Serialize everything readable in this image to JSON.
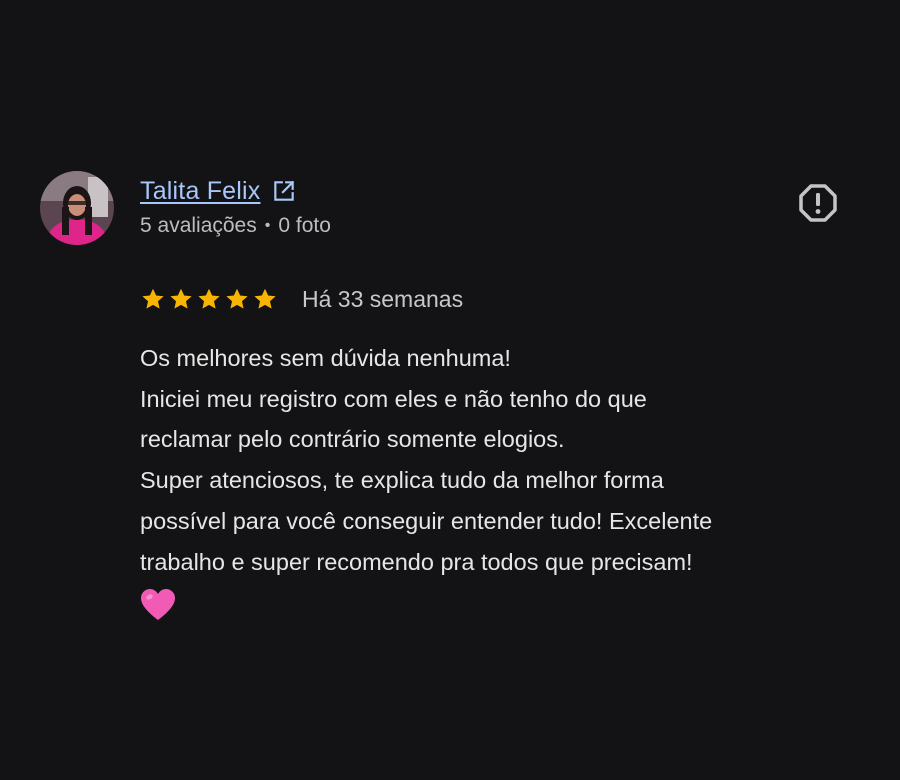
{
  "review": {
    "author": {
      "name": "Talita Felix",
      "reviews_count": "5 avaliações",
      "separator": "•",
      "photos_count": "0 foto"
    },
    "rating": 5,
    "time_ago": "Há 33 semanas",
    "text_lines": [
      "Os melhores sem dúvida nenhuma!",
      "Iniciei meu registro com eles e não tenho do que",
      "reclamar pelo contrário somente elogios.",
      "Super atenciosos, te explica tudo da melhor forma",
      "possível para você conseguir entender tudo! Excelente",
      "trabalho e super recomendo pra todos que precisam!"
    ],
    "emoji": "pink-heart-emoji"
  },
  "colors": {
    "background": "#131214",
    "link": "#a8c7fa",
    "star": "#f7b400",
    "text": "#e6e6e6",
    "muted": "#bdbdbd",
    "heart": "#f15bb5"
  },
  "icons": {
    "external": "open-in-new-icon",
    "report": "report-flag-icon",
    "star": "star-icon"
  }
}
